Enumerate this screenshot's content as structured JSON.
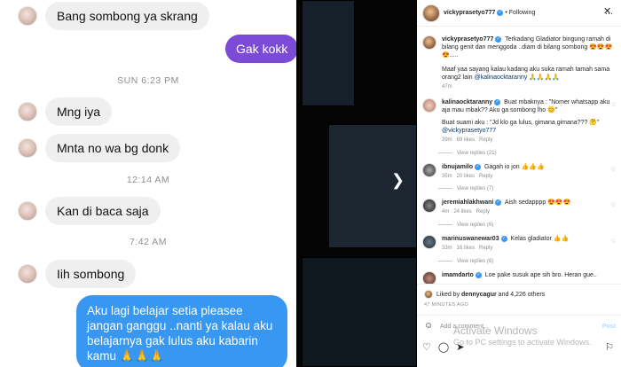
{
  "chat": {
    "messages": [
      {
        "text": "Bang sombong ya skrang"
      },
      {
        "text": "Gak kokk"
      },
      {
        "text": "Mng iya"
      },
      {
        "text": "Mnta no wa bg donk"
      },
      {
        "text": "Kan di baca saja"
      },
      {
        "text": "Iih sombong"
      },
      {
        "text": "Aku lagi belajar setia pleasee jangan ganggu ..nanti ya kalau aku belajarnya gak lulus aku kabarin kamu 🙏🙏🙏"
      }
    ],
    "timestamps": [
      "SUN 6:23 PM",
      "12:14 AM",
      "7:42 AM"
    ]
  },
  "instagram": {
    "header": {
      "username": "vickyprasetyo777",
      "follow_status": "• Following",
      "more": "⋯"
    },
    "close": "✕",
    "comments": [
      {
        "user": "vickyprasetyo777",
        "text": "Terkadang Gladiator bingung ramah di bilang genit dan menggoda ..diam di bilang sombong 😍😍😍😍.....",
        "text2": "Maaf yaa sayang kalau kadang aku suka ramah tamah sama orang2 lain",
        "mention": "@kalinaocktaranny",
        "emoji": "🙏🙏🙏🙏",
        "time": "47m"
      },
      {
        "user": "kalinaocktaranny",
        "text": "Buat mbaknya : \"Nomer whatsapp aku aja mau mbak?? Aku ga sombong lho 😊\"",
        "text2": "Buat suami aku : \"Jd klo ga lulus, gimana gimana??? 🤔\"",
        "mention": "@vickyprasetyo777",
        "time": "39m",
        "likes": "69 likes",
        "reply": "Reply",
        "view_replies": "View replies (21)"
      },
      {
        "user": "ibnujamilo",
        "text": "Gagah io jon 👍👍👍",
        "time": "35m",
        "likes": "20 likes",
        "reply": "Reply",
        "view_replies": "View replies (7)"
      },
      {
        "user": "jeremiahlakhwani",
        "text": "Aish sedapppp 😍😍😍",
        "time": "4m",
        "likes": "24 likes",
        "reply": "Reply",
        "view_replies": "View replies (6)"
      },
      {
        "user": "marinuswanewar03",
        "text": "Kelas gladiator 👍👍",
        "time": "33m",
        "likes": "16 likes",
        "reply": "Reply",
        "view_replies": "View replies (6)"
      },
      {
        "user": "imamdarto",
        "text": "Loe pake susuk ape sih bro. Heran gue.."
      }
    ],
    "footer": {
      "liked_by_prefix": "Liked by",
      "liked_user": "dennycagur",
      "liked_rest": "and 4,226 others",
      "ago": "47 MINUTES AGO",
      "add_comment": "Add a comment...",
      "post": "Post"
    },
    "watermark": {
      "title": "Activate Windows",
      "subtitle": "Go to PC settings to activate Windows."
    }
  }
}
